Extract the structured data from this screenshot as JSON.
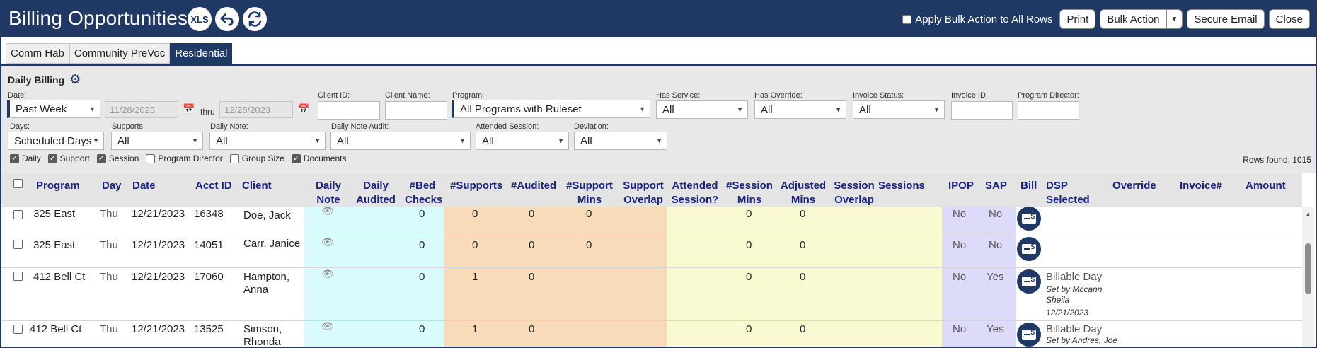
{
  "header": {
    "title": "Billing Opportunities",
    "xls_label": "XLS",
    "undo_icon": "undo-icon",
    "refresh_icon": "refresh-icon",
    "apply_bulk_label": "Apply Bulk Action to All Rows",
    "print_label": "Print",
    "bulk_action_label": "Bulk Action",
    "secure_email_label": "Secure Email",
    "close_label": "Close",
    "accent_color": "#1f3864"
  },
  "tabs": [
    {
      "label": "Comm Hab",
      "active": false
    },
    {
      "label": "Community PreVoc",
      "active": false
    },
    {
      "label": "Residential",
      "active": true
    }
  ],
  "section": {
    "title": "Daily Billing",
    "gear_icon": "gear-icon"
  },
  "filters": {
    "date_label": "Date:",
    "date_value": "Past Week",
    "date_from": "11/28/2023",
    "thru_label": "thru",
    "date_to": "12/28/2023",
    "client_id_label": "Client ID:",
    "client_name_label": "Client Name:",
    "program_label": "Program:",
    "program_value": "All Programs with Ruleset",
    "has_service_label": "Has Service:",
    "has_service_value": "All",
    "has_override_label": "Has Override:",
    "has_override_value": "All",
    "invoice_status_label": "Invoice Status:",
    "invoice_status_value": "All",
    "invoice_id_label": "Invoice ID:",
    "program_director_label": "Program Director:",
    "days_label": "Days:",
    "days_value": "Scheduled Days",
    "supports_label": "Supports:",
    "supports_value": "All",
    "daily_note_label": "Daily Note:",
    "daily_note_value": "All",
    "daily_note_audit_label": "Daily Note Audit:",
    "daily_note_audit_value": "All",
    "attended_session_label": "Attended Session:",
    "attended_session_value": "All",
    "deviation_label": "Deviation:",
    "deviation_value": "All"
  },
  "column_toggles": [
    {
      "label": "Daily",
      "checked": true
    },
    {
      "label": "Support",
      "checked": true
    },
    {
      "label": "Session",
      "checked": true
    },
    {
      "label": "Program Director",
      "checked": false
    },
    {
      "label": "Group Size",
      "checked": false
    },
    {
      "label": "Documents",
      "checked": true
    }
  ],
  "rows_found": "Rows found: 1015",
  "columns": {
    "program": "Program",
    "day": "Day",
    "date": "Date",
    "acct_id": "Acct ID",
    "client": "Client",
    "daily_note_1": "Daily",
    "daily_note_2": "Note",
    "daily_audited_1": "Daily",
    "daily_audited_2": "Audited",
    "bed_checks_1": "#Bed",
    "bed_checks_2": "Checks",
    "supports": "#Supports",
    "audited": "#Audited",
    "support_mins_1": "#Support",
    "support_mins_2": "Mins",
    "support_overlap_1": "Support",
    "support_overlap_2": "Overlap",
    "attended_session_1": "Attended",
    "attended_session_2": "Session?",
    "session_mins_1": "#Session",
    "session_mins_2": "Mins",
    "adjusted_mins_1": "Adjusted",
    "adjusted_mins_2": "Mins",
    "session_overlap_1": "Session",
    "session_overlap_2": "Overlap",
    "sessions": "Sessions",
    "ipop": "IPOP",
    "sap": "SAP",
    "bill": "Bill",
    "dsp_selected_1": "DSP",
    "dsp_selected_2": "Selected",
    "override": "Override",
    "invoice": "Invoice#",
    "amount": "Amount"
  },
  "band_colors": {
    "daily": "#d9fbfd",
    "support": "#f8dcb9",
    "session": "#fafad2",
    "ipop_sap": "#dcdcfa"
  },
  "rows": [
    {
      "program": "325 East",
      "day": "Thu",
      "date": "12/21/2023",
      "acct_id": "16348",
      "client_1": "Doe, Jack",
      "client_2": "",
      "bed_checks": "0",
      "supports": "0",
      "audited": "0",
      "support_mins": "0",
      "session_mins": "0",
      "adjusted_mins": "0",
      "ipop": "No",
      "sap": "No",
      "dsp_selected": "",
      "set_by_1": "",
      "set_by_2": "",
      "set_date": ""
    },
    {
      "program": "325 East",
      "day": "Thu",
      "date": "12/21/2023",
      "acct_id": "14051",
      "client_1": "Carr, Janice",
      "client_2": "",
      "bed_checks": "0",
      "supports": "0",
      "audited": "0",
      "support_mins": "0",
      "session_mins": "0",
      "adjusted_mins": "0",
      "ipop": "No",
      "sap": "No",
      "dsp_selected": "",
      "set_by_1": "",
      "set_by_2": "",
      "set_date": ""
    },
    {
      "program": "412 Bell Ct",
      "day": "Thu",
      "date": "12/21/2023",
      "acct_id": "17060",
      "client_1": "Hampton,",
      "client_2": "Anna",
      "bed_checks": "0",
      "supports": "1",
      "audited": "0",
      "support_mins": "",
      "session_mins": "0",
      "adjusted_mins": "0",
      "ipop": "No",
      "sap": "Yes",
      "dsp_selected": "Billable Day",
      "set_by_1": "Set by Mccann,",
      "set_by_2": "Sheila",
      "set_date": "12/21/2023"
    },
    {
      "program": "412 Bell Ct",
      "day": "Thu",
      "date": "12/21/2023",
      "acct_id": "13525",
      "client_1": "Simson,",
      "client_2": "Rhonda",
      "bed_checks": "0",
      "supports": "1",
      "audited": "0",
      "support_mins": "",
      "session_mins": "0",
      "adjusted_mins": "0",
      "ipop": "No",
      "sap": "Yes",
      "dsp_selected": "Billable Day",
      "set_by_1": "Set by Andres, Joe",
      "set_by_2": "",
      "set_date": ""
    }
  ]
}
